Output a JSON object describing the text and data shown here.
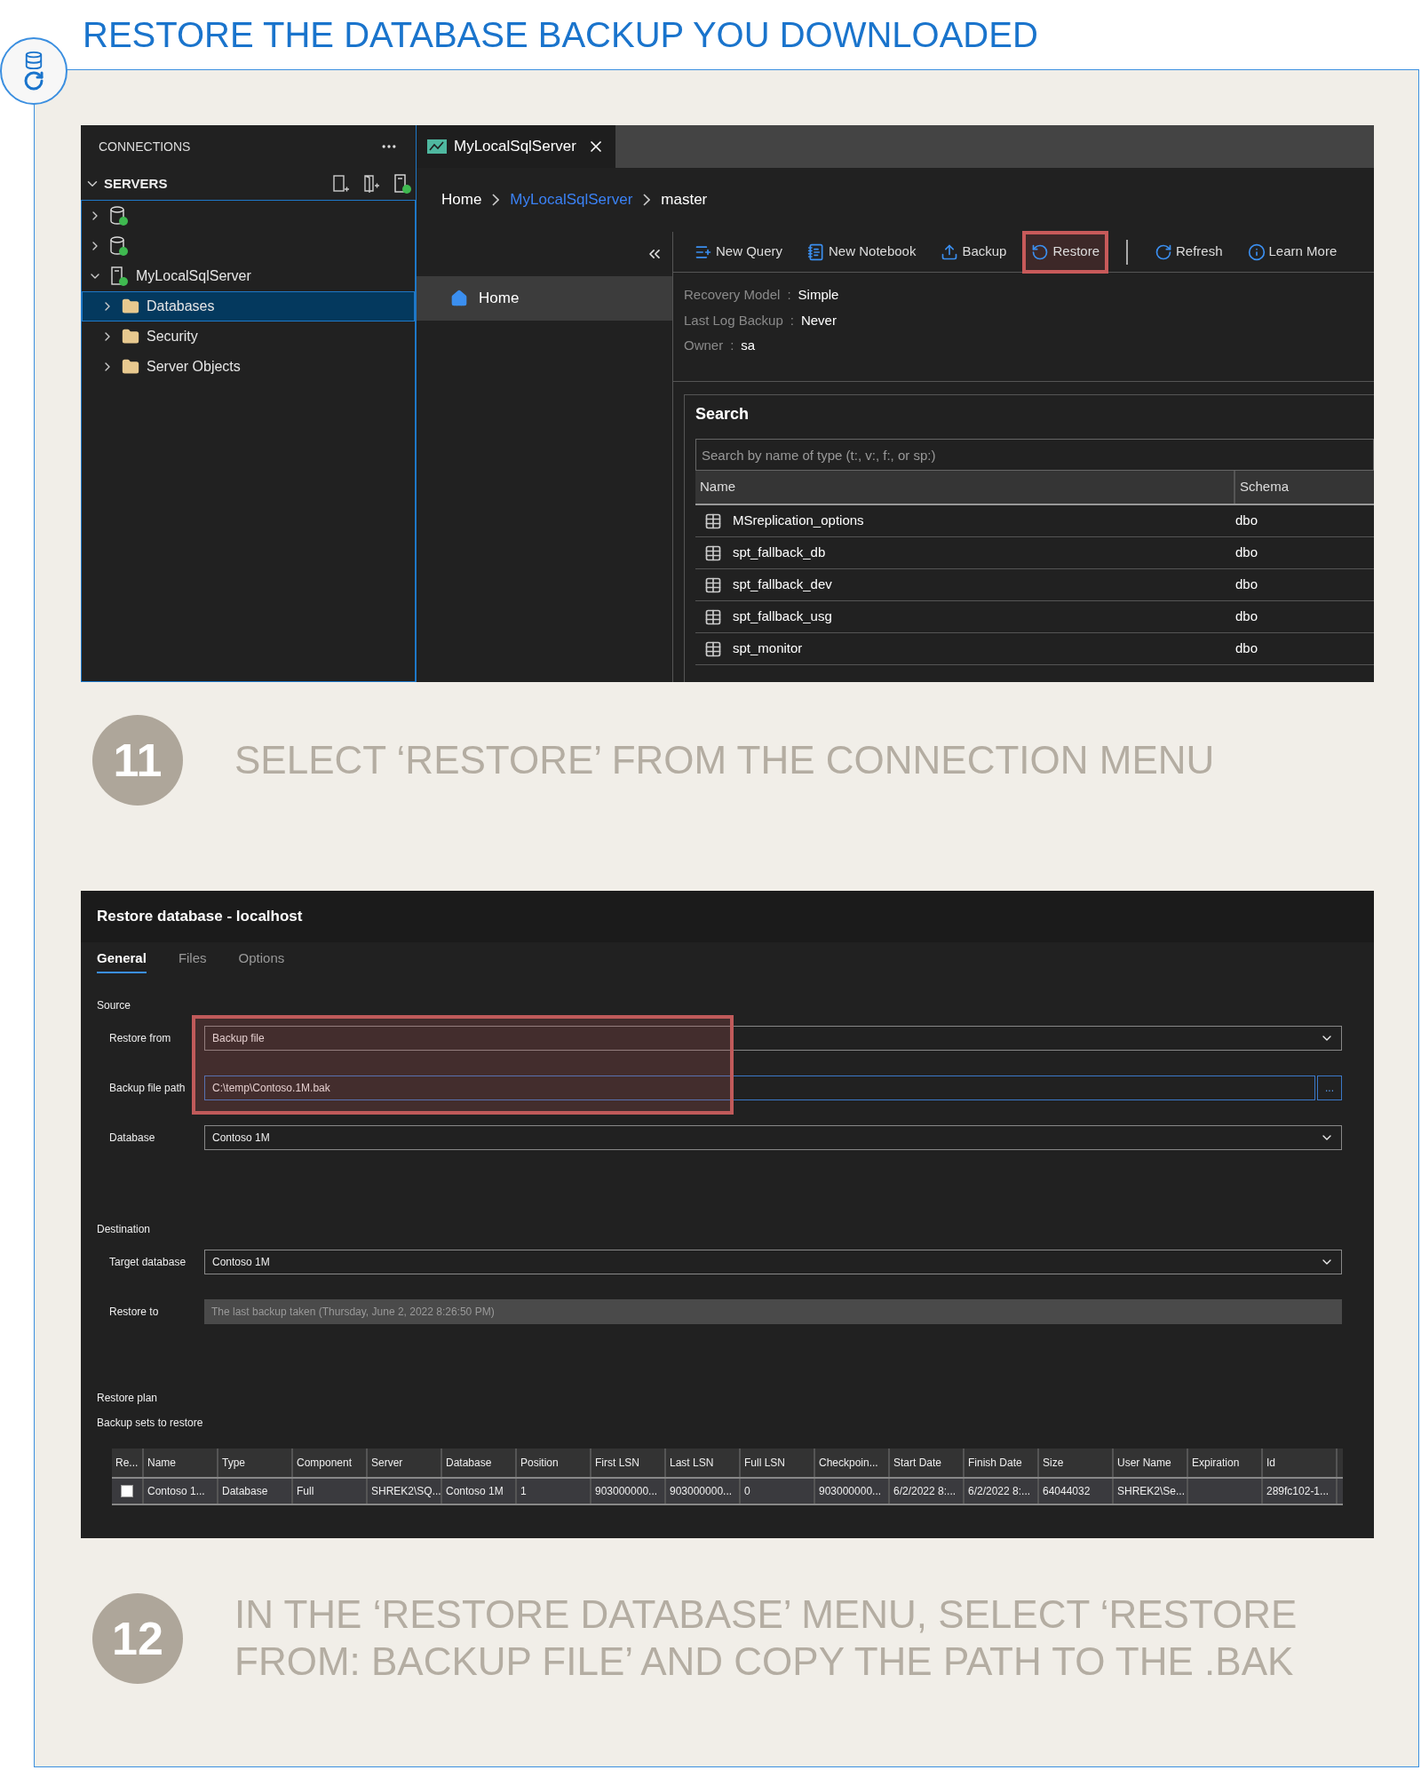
{
  "title": "RESTORE THE DATABASE BACKUP YOU DOWNLOADED",
  "screenshot_1": {
    "connections": {
      "title": "CONNECTIONS",
      "section": "SERVERS",
      "section_expanded": true,
      "tree": [
        {
          "kind": "sql",
          "expanded": false,
          "selected": false
        },
        {
          "kind": "sql",
          "expanded": false,
          "selected": false
        },
        {
          "kind": "server",
          "label": "MyLocalSqlServer",
          "expanded": true,
          "selected": false,
          "children": [
            {
              "kind": "folder",
              "label": "Databases",
              "expanded": false,
              "selected": true
            },
            {
              "kind": "folder",
              "label": "Security",
              "expanded": false,
              "selected": false
            },
            {
              "kind": "folder",
              "label": "Server Objects",
              "expanded": false,
              "selected": false
            }
          ]
        }
      ]
    },
    "tabs": [
      {
        "label": "MyLocalSqlServer",
        "selected": true
      }
    ],
    "breadcrumb": [
      {
        "label": "Home",
        "kind": "text"
      },
      {
        "label": "MyLocalSqlServer",
        "kind": "link"
      },
      {
        "label": "master",
        "kind": "text"
      }
    ],
    "nav": [
      {
        "label": "Home",
        "selected": true
      }
    ],
    "toolbar": [
      {
        "label": "New Query",
        "highlighted": false
      },
      {
        "label": "New Notebook",
        "highlighted": false
      },
      {
        "label": "Backup",
        "highlighted": false
      },
      {
        "label": "Restore",
        "highlighted": true
      },
      {
        "label": "Refresh",
        "highlighted": false
      },
      {
        "label": "Learn More",
        "highlighted": false
      }
    ],
    "properties": [
      {
        "label": "Recovery Model",
        "separator": ":",
        "value": "Simple"
      },
      {
        "label": "Last Log Backup",
        "separator": ":",
        "value": "Never"
      },
      {
        "label": "Owner",
        "separator": ":",
        "value": "sa"
      }
    ],
    "search": {
      "title": "Search",
      "placeholder": "Search by name of type (t:, v:, f:, or sp:)",
      "columns": [
        "Name",
        "Schema"
      ],
      "rows": [
        {
          "name": "MSreplication_options",
          "schema": "dbo"
        },
        {
          "name": "spt_fallback_db",
          "schema": "dbo"
        },
        {
          "name": "spt_fallback_dev",
          "schema": "dbo"
        },
        {
          "name": "spt_fallback_usg",
          "schema": "dbo"
        },
        {
          "name": "spt_monitor",
          "schema": "dbo"
        }
      ]
    }
  },
  "steps": [
    {
      "number": "11",
      "text": "SELECT ‘RESTORE’ FROM THE CONNECTION MENU"
    },
    {
      "number": "12",
      "text": "IN THE ‘RESTORE DATABASE’ MENU, SELECT ‘RESTORE FROM: BACKUP FILE’ AND COPY THE PATH TO THE .BAK"
    }
  ],
  "screenshot_2": {
    "title": "Restore database - localhost",
    "tabs": [
      {
        "label": "General",
        "selected": true
      },
      {
        "label": "Files",
        "selected": false
      },
      {
        "label": "Options",
        "selected": false
      }
    ],
    "source": {
      "label": "Source",
      "fields": [
        {
          "label": "Restore from",
          "kind": "dropdown",
          "value": "Backup file",
          "highlighted": true
        },
        {
          "label": "Backup file path",
          "kind": "file",
          "value": "C:\\temp\\Contoso.1M.bak",
          "button": "...",
          "highlighted": true
        },
        {
          "label": "Database",
          "kind": "dropdown",
          "value": "Contoso 1M",
          "highlighted": false
        }
      ]
    },
    "destination": {
      "label": "Destination",
      "fields": [
        {
          "label": "Target database",
          "kind": "dropdown",
          "value": "Contoso 1M"
        },
        {
          "label": "Restore to",
          "kind": "readonly",
          "value": "The last backup taken (Thursday, June 2, 2022 8:26:50 PM)"
        }
      ]
    },
    "plan_label": "Restore plan",
    "sets_label": "Backup sets to restore",
    "table": {
      "columns": [
        "Re...",
        "Name",
        "Type",
        "Component",
        "Server",
        "Database",
        "Position",
        "First LSN",
        "Last LSN",
        "Full LSN",
        "Checkpoin...",
        "Start Date",
        "Finish Date",
        "Size",
        "User Name",
        "Expiration",
        "Id"
      ],
      "rows": [
        {
          "checked": false,
          "cells": [
            "",
            "Contoso 1...",
            "Database",
            "Full",
            "SHREK2\\SQ...",
            "Contoso 1M",
            "1",
            "903000000...",
            "903000000...",
            "0",
            "903000000...",
            "6/2/2022 8:...",
            "6/2/2022 8:...",
            "64044032",
            "SHREK2\\Se...",
            "",
            "289fc102-1..."
          ]
        }
      ]
    }
  }
}
